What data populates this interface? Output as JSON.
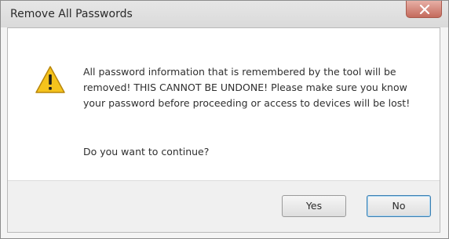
{
  "window": {
    "title": "Remove All Passwords"
  },
  "dialog": {
    "message": "All password information that is remembered by the tool will be removed!  THIS CANNOT BE UNDONE!  Please make sure you know your password before proceeding or access to devices will be lost!",
    "question": "Do you want to continue?",
    "icon": "warning-icon"
  },
  "buttons": {
    "yes_label": "Yes",
    "no_label": "No"
  },
  "colors": {
    "close_button": "#c46a5c",
    "warning_icon": "#f5c31c",
    "default_button_border": "#3c7fb1"
  }
}
